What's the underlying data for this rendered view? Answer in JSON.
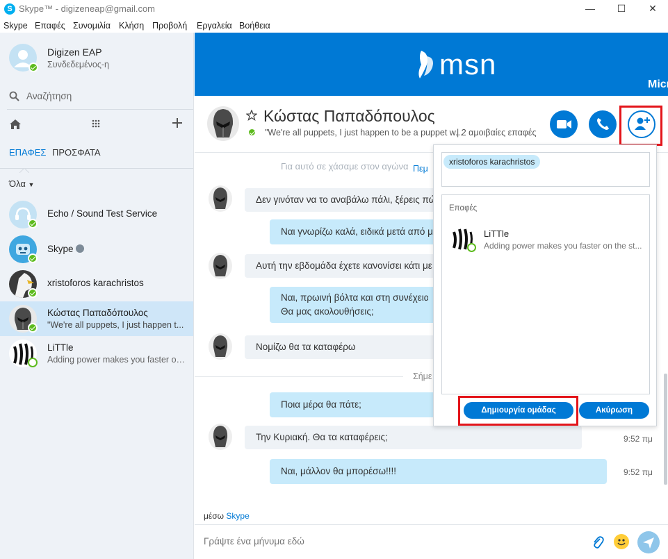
{
  "window": {
    "title": "Skype™ - digizeneap@gmail.com",
    "minimize": "—",
    "maximize": "☐",
    "close": "✕"
  },
  "menu": [
    "Skype",
    "Επαφές",
    "Συνομιλία",
    "Κλήση",
    "Προβολή",
    "Εργαλεία",
    "Βοήθεια"
  ],
  "profile": {
    "name": "Digizen EAP",
    "status": "Συνδεδεμένος-η"
  },
  "search": {
    "placeholder": "Αναζήτηση"
  },
  "tabs": {
    "contacts": "ΕΠΑΦΕΣ",
    "recent": "ΠΡΟΣΦΑΤΑ"
  },
  "filter": {
    "label": "Όλα"
  },
  "contacts": [
    {
      "name": "Echo / Sound Test Service",
      "sub": ""
    },
    {
      "name": "Skype",
      "sub": ""
    },
    {
      "name": "xristoforos karachristos",
      "sub": ""
    },
    {
      "name": "Κώστας Παπαδόπουλος",
      "sub": "\"We're all puppets, I just happen t..."
    },
    {
      "name": "LiTTle",
      "sub": "Adding power makes you faster on..."
    }
  ],
  "banner": {
    "brand": "msn",
    "corner_text": "Micr"
  },
  "chat_header": {
    "name": "Κώστας Παπαδόπουλος",
    "mood": "\"We're all puppets, I just happen to be a puppet w...",
    "shared": "| 2 αμοιβαίες επαφές"
  },
  "messages": {
    "faded_top": "Για αυτό σε χάσαμε στον αγώνα",
    "faded_right": "Πεμ",
    "m1": "Δεν γινόταν να το αναβάλω πάλι, ξέρεις πώ",
    "m2": "Ναι γνωρίζω καλά, ειδικά μετά από μ",
    "m3": "Αυτή την εβδομάδα έχετε κανονίσει κάτι με",
    "m4_line1": "Ναι, πρωινή βόλτα και στη συνέχεια μ",
    "m4_line2": "Θα μας ακολουθήσεις;",
    "m5": "Νομίζω θα τα καταφέρω",
    "day_divider": "Σήμε",
    "m6": "Ποια μέρα θα πάτε;",
    "m7": "Την Κυριακή. Θα τα καταφέρεις;",
    "m7_time": "9:52 πμ",
    "m8": "Ναι, μάλλον θα μπορέσω!!!!",
    "m8_time": "9:52 πμ"
  },
  "via": {
    "prefix": "μέσω",
    "service": "Skype"
  },
  "composer": {
    "placeholder": "Γράψτε ένα μήνυμα εδώ"
  },
  "popup": {
    "selected_chip": "xristoforos karachristos",
    "section_label": "Επαφές",
    "contact_name": "LiTTle",
    "contact_sub": "Adding power makes you faster on the st...",
    "create_button": "Δημιουργία ομάδας",
    "cancel_button": "Ακύρωση"
  },
  "colors": {
    "accent": "#0079d5",
    "highlight": "#e3141a",
    "online": "#5dbb1e",
    "outgoing_bubble": "#c7eafb"
  }
}
